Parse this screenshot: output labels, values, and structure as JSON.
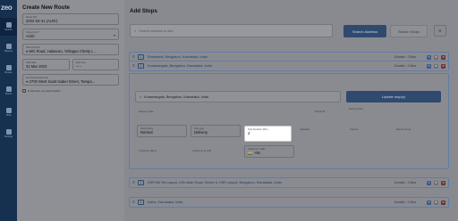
{
  "app": {
    "logo": "zeo",
    "nav": [
      {
        "label": "Search"
      },
      {
        "label": "Delivery"
      },
      {
        "label": "Routes"
      },
      {
        "label": "Stores"
      },
      {
        "label": "Chat"
      },
      {
        "label": "Settings"
      }
    ]
  },
  "form": {
    "title": "Create New Route",
    "route_title": {
      "label": "Route Title",
      "value": "2022-03-31 (AUIC)"
    },
    "stop_form": {
      "label": "Stops Form*",
      "value": "AUIC"
    },
    "start_location": {
      "label": "Start location*",
      "value": "MG Road, Halasuru, Yellappa Chetty L..."
    },
    "start_date": {
      "label": "Start date",
      "value": "31 Mar 2023"
    },
    "start_time": {
      "label": "Start time",
      "value": "--:--"
    },
    "end_location": {
      "label": "End location(optional)",
      "value": "2700 West Saint Isabel Street, Tampa..."
    },
    "checkbox": {
      "label": "Customize my start location"
    }
  },
  "main": {
    "title": "Add Stops",
    "search_placeholder": "Search address to add",
    "search_address_button": "Search Address",
    "search_stops_button": "Search Stops",
    "stops": [
      {
        "num": "1",
        "address": "Shivaleela, Bengaluru, Karnataka, India",
        "duration": "Duration : 2 Mins"
      },
      {
        "num": "2",
        "address": "Koramangala, Bengaluru, Karnataka, India",
        "duration": "Duration : 2 Mins"
      },
      {
        "num": "3",
        "address": "HSR 6th Rd Layout, 12th Main Road, Sector 6, HSR Layout, Bengaluru, Karnataka, India",
        "duration": "Duration : 2 Mins"
      },
      {
        "num": "4",
        "address": "Indira, Karnataka, India",
        "duration": "Duration : 2 Mins"
      }
    ],
    "expanded": {
      "address": "Koramangala, Bengaluru, Karnataka, India",
      "update_button": "Update stop(s)",
      "delivery_note": "Delivery Note",
      "parcel_id": "Parcel ID",
      "delivery_date": "Delivery Slot",
      "stop_priority": {
        "label": "Stop Priority",
        "value": "Normal"
      },
      "stop_type": {
        "label": "Stop type",
        "value": "Delivery"
      },
      "stop_duration": {
        "label": "Stop Duration (Min.)",
        "value": "2"
      },
      "capacity": "Capacity",
      "volume": "Volume",
      "parcel_count": "Parcel Count",
      "customer_name": "Customer Name",
      "customer_email": "Customer E-mail",
      "customer_phone": {
        "label": "Customer's Calls",
        "value": "+91"
      }
    }
  }
}
